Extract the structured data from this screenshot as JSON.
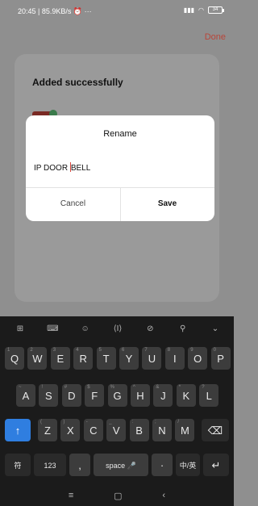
{
  "status_bar": {
    "left": "20:45 | 85.9KB/s ⏰ ···",
    "signal": "⁴ᴳ📶",
    "wifi": "📶",
    "battery": "34"
  },
  "header": {
    "done_label": "Done"
  },
  "card": {
    "title": "Added successfully"
  },
  "dialog": {
    "title": "Rename",
    "value_before_cursor": "IP DOOR ",
    "value_after_cursor": "BELL",
    "cancel_label": "Cancel",
    "save_label": "Save"
  },
  "keyboard": {
    "toolbar": [
      "⊞",
      "⌨",
      "☺",
      "⟨I⟩",
      "⊘",
      "⚲",
      "⌄"
    ],
    "row1": [
      {
        "k": "Q",
        "h": "1"
      },
      {
        "k": "W",
        "h": "2"
      },
      {
        "k": "E",
        "h": "3"
      },
      {
        "k": "R",
        "h": "4"
      },
      {
        "k": "T",
        "h": "5"
      },
      {
        "k": "Y",
        "h": "6"
      },
      {
        "k": "U",
        "h": "7"
      },
      {
        "k": "I",
        "h": "8"
      },
      {
        "k": "O",
        "h": "9"
      },
      {
        "k": "P",
        "h": "0"
      }
    ],
    "row2": [
      {
        "k": "A",
        "h": "~"
      },
      {
        "k": "S",
        "h": "!"
      },
      {
        "k": "D",
        "h": "#"
      },
      {
        "k": "F",
        "h": "$"
      },
      {
        "k": "G",
        "h": "%"
      },
      {
        "k": "H",
        "h": "^"
      },
      {
        "k": "J",
        "h": "&"
      },
      {
        "k": "K",
        "h": "*"
      },
      {
        "k": "L",
        "h": "?"
      }
    ],
    "row3": [
      {
        "k": "Z",
        "h": "("
      },
      {
        "k": "X",
        "h": ")"
      },
      {
        "k": "C",
        "h": "-"
      },
      {
        "k": "V",
        "h": "_"
      },
      {
        "k": "B",
        "h": ":"
      },
      {
        "k": "N",
        "h": ";"
      },
      {
        "k": "M",
        "h": "/"
      }
    ],
    "shift": "↑",
    "backspace": "⌫",
    "symbols": "符",
    "numbers": "123",
    "comma": ",",
    "space": "space 🎤",
    "period": "·",
    "lang": "中/英",
    "enter": "↵"
  },
  "nav_bar": {
    "menu": "≡",
    "home": "▢",
    "back": "‹"
  }
}
